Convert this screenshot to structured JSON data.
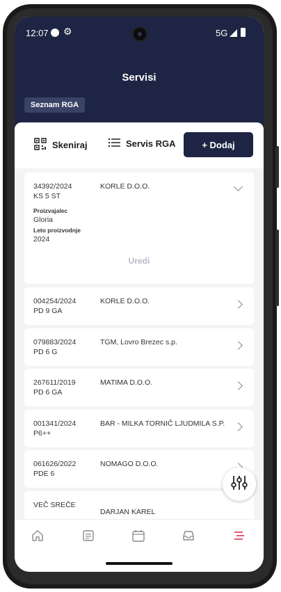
{
  "status_bar": {
    "time": "12:07",
    "network": "5G"
  },
  "header": {
    "title": "Servisi",
    "subtitle": "Seznam RGA"
  },
  "toolbar": {
    "scan_label": "Skeniraj",
    "servis_label": "Servis RGA",
    "add_label": "+ Dodaj"
  },
  "records": [
    {
      "number": "34392/2024",
      "model": "KS 5 ST",
      "company": "KORLE D.O.O.",
      "expanded": true,
      "producer_label": "Proizvajalec",
      "producer": "Gloria",
      "year_label": "Leto proizvodnje",
      "year": "2024",
      "edit_label": "Uredi"
    },
    {
      "number": "004254/2024",
      "model": "PD 9 GA",
      "company": "KORLE D.O.O."
    },
    {
      "number": "079883/2024",
      "model": "PD 6 G",
      "company": "TGM, Lovro Brezec s.p."
    },
    {
      "number": "267611/2019",
      "model": "PD 6 GA",
      "company": "MATIMA D.O.O."
    },
    {
      "number": "001341/2024",
      "model": "P6++",
      "company": "BAR - MILKA TORNIČ LJUDMILA S.P."
    },
    {
      "number": "061626/2022",
      "model": "PDE 6",
      "company": "NOMAGO D.O.O."
    },
    {
      "number": "VEČ SREČE",
      "model": "",
      "company": "DARJAN KAREL"
    }
  ],
  "nav": {
    "items": [
      "home",
      "documents",
      "calendar",
      "inbox",
      "menu"
    ],
    "active": "menu",
    "accent": "#e0334f",
    "inactive": "#8a8a8a"
  },
  "colors": {
    "header": "#1e2544",
    "chip": "#3a4266"
  }
}
